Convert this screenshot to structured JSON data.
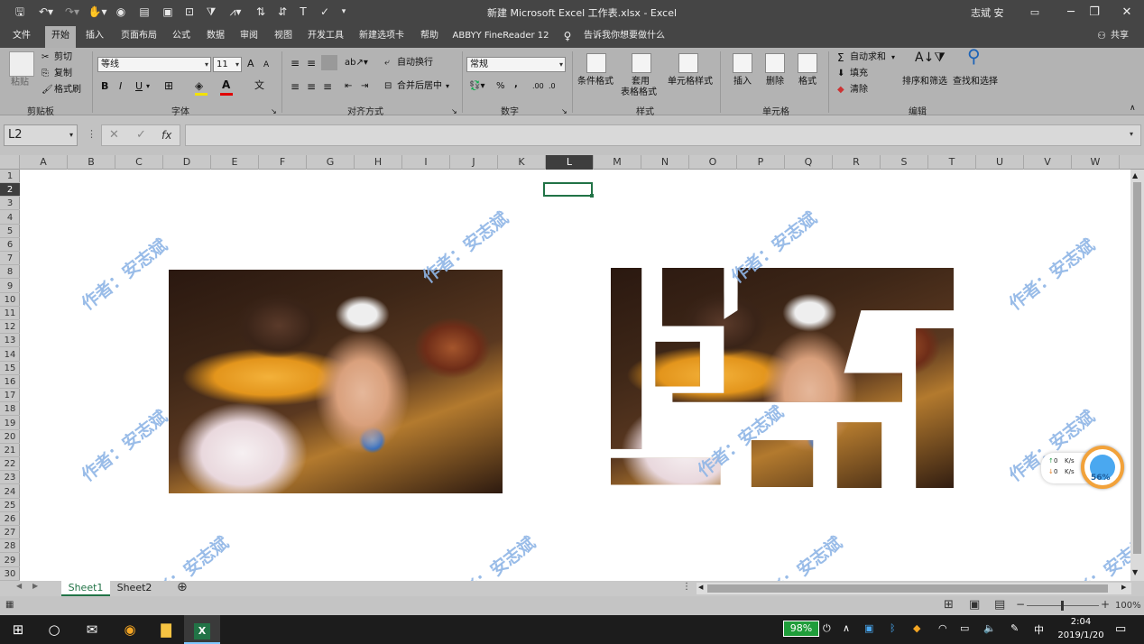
{
  "titlebar": {
    "title": "新建 Microsoft Excel 工作表.xlsx  -  Excel",
    "user": "志斌 安"
  },
  "ribbon_tabs": [
    "文件",
    "开始",
    "插入",
    "页面布局",
    "公式",
    "数据",
    "审阅",
    "视图",
    "开发工具",
    "新建选项卡",
    "帮助",
    "ABBYY FineReader 12"
  ],
  "tell_me": "告诉我你想要做什么",
  "share": "共享",
  "clipboard": {
    "paste": "粘贴",
    "cut": "剪切",
    "copy": "复制",
    "format_painter": "格式刷",
    "label": "剪贴板"
  },
  "font": {
    "name": "等线",
    "size": "11",
    "grow": "A",
    "shrink": "A",
    "bold": "B",
    "italic": "I",
    "underline": "U",
    "label": "字体"
  },
  "alignment": {
    "wrap": "自动换行",
    "merge": "合并后居中",
    "label": "对齐方式"
  },
  "number": {
    "format": "常规",
    "percent": "%",
    "comma": ",",
    "label": "数字"
  },
  "styles": {
    "conditional": "条件格式",
    "table_l1": "套用",
    "table_l2": "表格格式",
    "cell_styles": "单元格样式",
    "label": "样式"
  },
  "cells": {
    "insert": "插入",
    "delete": "删除",
    "format": "格式",
    "label": "单元格"
  },
  "editing": {
    "autosum": "自动求和",
    "fill": "填充",
    "clear": "清除",
    "sort": "排序和筛选",
    "find": "查找和选择",
    "label": "编辑"
  },
  "formula_bar": {
    "name_box": "L2",
    "fx": "fx",
    "value": ""
  },
  "columns": [
    "A",
    "B",
    "C",
    "D",
    "E",
    "F",
    "G",
    "H",
    "I",
    "J",
    "K",
    "L",
    "M",
    "N",
    "O",
    "P",
    "Q",
    "R",
    "S",
    "T",
    "U",
    "V",
    "W"
  ],
  "selected_column": "L",
  "rows": [
    "1",
    "2",
    "3",
    "4",
    "5",
    "6",
    "7",
    "8",
    "9",
    "10",
    "11",
    "12",
    "13",
    "14",
    "15",
    "16",
    "17",
    "18",
    "19",
    "20",
    "21",
    "22",
    "23",
    "24",
    "25",
    "26",
    "27",
    "28",
    "29",
    "30"
  ],
  "selected_row": "2",
  "watermark": "作者：安志斌",
  "sheets": [
    "Sheet1",
    "Sheet2"
  ],
  "active_sheet": "Sheet1",
  "zoom": "100%",
  "net_widget": {
    "up": "0",
    "down": "0",
    "unit": "K/s",
    "percent": "56%"
  },
  "taskbar": {
    "battery": "98%",
    "time": "2:04",
    "date": "2019/1/20"
  }
}
